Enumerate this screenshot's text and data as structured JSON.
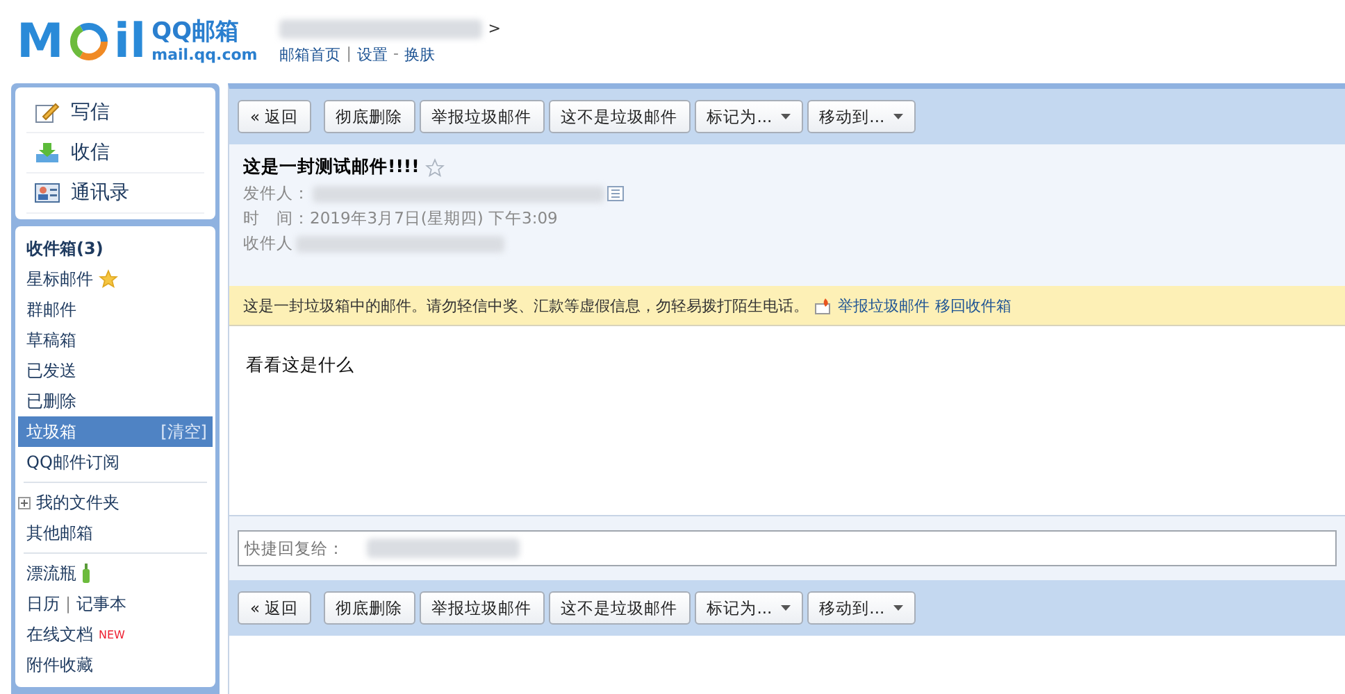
{
  "header": {
    "logo": {
      "letters_left": "M",
      "letters_right": "il",
      "name": "QQ邮箱",
      "domain": "mail.qq.com"
    },
    "user_suffix": ">",
    "nav": [
      {
        "kind": "link",
        "label": "邮箱首页"
      },
      {
        "kind": "sep",
        "label": "|"
      },
      {
        "kind": "link",
        "label": "设置"
      },
      {
        "kind": "sep",
        "label": "-"
      },
      {
        "kind": "link",
        "label": "换肤"
      }
    ]
  },
  "sidebar": {
    "actions": [
      {
        "kind": "compose",
        "label": "写信"
      },
      {
        "kind": "receive",
        "label": "收信"
      },
      {
        "kind": "contacts",
        "label": "通讯录"
      }
    ],
    "groups": [
      {
        "items": [
          {
            "label": "收件箱(3)",
            "bold": true,
            "selected": false
          },
          {
            "kind": "starred",
            "label": "星标邮件",
            "selected": false
          },
          {
            "label": "群邮件",
            "selected": false
          },
          {
            "label": "草稿箱",
            "selected": false
          },
          {
            "label": "已发送",
            "selected": false
          },
          {
            "label": "已删除",
            "selected": false
          },
          {
            "label": "垃圾箱",
            "extra": "[清空]",
            "selected": true
          },
          {
            "label": "QQ邮件订阅",
            "selected": false
          }
        ]
      },
      {
        "items": [
          {
            "kind": "folder_group",
            "label": "我的文件夹",
            "expanded": false,
            "selected": false
          },
          {
            "label": "其他邮箱",
            "selected": false
          }
        ]
      },
      {
        "items": [
          {
            "kind": "bottle",
            "label": "漂流瓶",
            "selected": false
          },
          {
            "label": "日历",
            "sep": "|",
            "label2": "记事本",
            "selected": false
          },
          {
            "label": "在线文档",
            "badge": "NEW",
            "selected": false
          },
          {
            "label": "附件收藏",
            "selected": false
          }
        ]
      }
    ]
  },
  "toolbar_top": [
    {
      "kind": "back",
      "label": "« 返回"
    },
    {
      "kind": "button",
      "label": "彻底删除"
    },
    {
      "kind": "button",
      "label": "举报垃圾邮件"
    },
    {
      "kind": "button",
      "label": "这不是垃圾邮件"
    },
    {
      "kind": "dropdown",
      "label": "标记为..."
    },
    {
      "kind": "dropdown",
      "label": "移动到..."
    }
  ],
  "email": {
    "subject": "这是一封测试邮件!!!!",
    "starred": false,
    "from_label": "发件人：",
    "time_label": "时　间：",
    "time": "2019年3月7日(星期四) 下午3:09",
    "to_label": "收件人"
  },
  "warning": {
    "text": "这是一封垃圾箱中的邮件。请勿轻信中奖、汇款等虚假信息，勿轻易拨打陌生电话。",
    "links": [
      "举报垃圾邮件",
      "移回收件箱"
    ]
  },
  "body": "看看这是什么",
  "quick_reply": {
    "placeholder": "快捷回复给："
  },
  "toolbar_bottom": [
    {
      "kind": "back",
      "label": "« 返回"
    },
    {
      "kind": "button",
      "label": "彻底删除"
    },
    {
      "kind": "button",
      "label": "举报垃圾邮件"
    },
    {
      "kind": "button",
      "label": "这不是垃圾邮件"
    },
    {
      "kind": "dropdown",
      "label": "标记为..."
    },
    {
      "kind": "dropdown",
      "label": "移动到..."
    }
  ]
}
